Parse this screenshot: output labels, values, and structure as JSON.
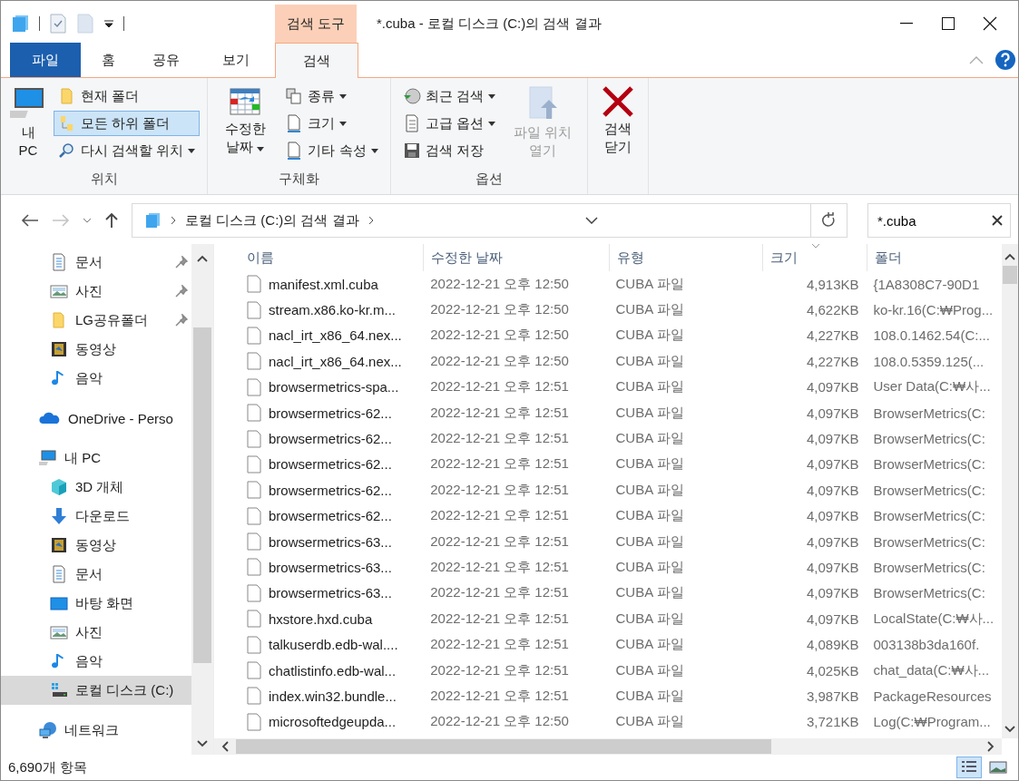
{
  "window": {
    "title": "*.cuba - 로컬 디스크 (C:)의 검색 결과",
    "context_tab": "검색 도구"
  },
  "tabs": [
    {
      "label": "파일",
      "kind": "file",
      "selected": false
    },
    {
      "label": "홈",
      "kind": "tab",
      "selected": false
    },
    {
      "label": "공유",
      "kind": "tab",
      "selected": false
    },
    {
      "label": "보기",
      "kind": "tab",
      "selected": false
    },
    {
      "label": "검색",
      "kind": "tab",
      "selected": true
    }
  ],
  "ribbon": {
    "groups": [
      {
        "label": "위치",
        "columns": [
          [
            {
              "label": "내 PC",
              "kind": "pc"
            }
          ],
          [
            {
              "label": "현재 폴더",
              "kind": "folder",
              "selected": false
            },
            {
              "label": "모든 하위 폴더",
              "kind": "subfolders",
              "selected": true
            },
            {
              "label": "다시 검색할 위치",
              "kind": "research",
              "dropdown": true,
              "selected": false
            }
          ]
        ]
      },
      {
        "label": "구체화",
        "columns": [
          [
            {
              "label": "수정한 날짜",
              "kind": "calendar",
              "dropdown": true
            }
          ],
          [
            {
              "label": "종류",
              "kind": "kind",
              "dropdown": true
            },
            {
              "label": "크기",
              "kind": "page",
              "dropdown": true
            },
            {
              "label": "기타 속성",
              "kind": "page",
              "dropdown": true
            }
          ]
        ]
      },
      {
        "label": "옵션",
        "columns": [
          [
            {
              "label": "최근 검색",
              "kind": "recent",
              "dropdown": true
            },
            {
              "label": "고급 옵션",
              "kind": "advanced",
              "dropdown": true
            },
            {
              "label": "검색 저장",
              "kind": "save"
            }
          ],
          [
            {
              "label": "파일 위치 열기",
              "kind": "openloc",
              "disabled": true
            }
          ]
        ]
      },
      {
        "columns": [
          [
            {
              "label": "검색 닫기",
              "kind": "closex"
            }
          ]
        ]
      }
    ]
  },
  "address": {
    "path": "로컬 디스크 (C:)의 검색 결과"
  },
  "search": {
    "value": "*.cuba"
  },
  "sidebar": {
    "quick_access": [
      {
        "label": "문서",
        "kind": "documents",
        "pinned": true,
        "selected": false
      },
      {
        "label": "사진",
        "kind": "pictures",
        "pinned": true,
        "selected": false
      },
      {
        "label": "LG공유폴더",
        "kind": "folder",
        "pinned": true,
        "selected": false
      },
      {
        "label": "동영상",
        "kind": "videos",
        "pinned": false,
        "selected": false
      },
      {
        "label": "음악",
        "kind": "music",
        "pinned": false,
        "selected": false
      }
    ],
    "tree": [
      {
        "label": "OneDrive - Perso",
        "kind": "cloud",
        "selected": false
      },
      {
        "label": "내 PC",
        "kind": "pc",
        "selected": false,
        "children": [
          {
            "label": "3D 개체",
            "kind": "cube",
            "selected": false
          },
          {
            "label": "다운로드",
            "kind": "downloads",
            "selected": false
          },
          {
            "label": "동영상",
            "kind": "videos",
            "selected": false
          },
          {
            "label": "문서",
            "kind": "documents",
            "selected": false
          },
          {
            "label": "바탕 화면",
            "kind": "desktop",
            "selected": false
          },
          {
            "label": "사진",
            "kind": "pictures",
            "selected": false
          },
          {
            "label": "음악",
            "kind": "music",
            "selected": false
          },
          {
            "label": "로컬 디스크 (C:)",
            "kind": "drive",
            "selected": true
          }
        ]
      },
      {
        "label": "네트워크",
        "kind": "network",
        "selected": false
      }
    ]
  },
  "table": {
    "columns": [
      "이름",
      "수정한 날짜",
      "유형",
      "크기",
      "폴더"
    ],
    "rows": [
      [
        "manifest.xml.cuba",
        "2022-12-21 오후 12:50",
        "CUBA 파일",
        "4,913KB",
        "{1A8308C7-90D1"
      ],
      [
        "stream.x86.ko-kr.m...",
        "2022-12-21 오후 12:50",
        "CUBA 파일",
        "4,622KB",
        "ko-kr.16(C:₩Prog..."
      ],
      [
        "nacl_irt_x86_64.nex...",
        "2022-12-21 오후 12:50",
        "CUBA 파일",
        "4,227KB",
        "108.0.1462.54(C:..."
      ],
      [
        "nacl_irt_x86_64.nex...",
        "2022-12-21 오후 12:50",
        "CUBA 파일",
        "4,227KB",
        "108.0.5359.125(..."
      ],
      [
        "browsermetrics-spa...",
        "2022-12-21 오후 12:51",
        "CUBA 파일",
        "4,097KB",
        "User Data(C:₩사..."
      ],
      [
        "browsermetrics-62...",
        "2022-12-21 오후 12:51",
        "CUBA 파일",
        "4,097KB",
        "BrowserMetrics(C:"
      ],
      [
        "browsermetrics-62...",
        "2022-12-21 오후 12:51",
        "CUBA 파일",
        "4,097KB",
        "BrowserMetrics(C:"
      ],
      [
        "browsermetrics-62...",
        "2022-12-21 오후 12:51",
        "CUBA 파일",
        "4,097KB",
        "BrowserMetrics(C:"
      ],
      [
        "browsermetrics-62...",
        "2022-12-21 오후 12:51",
        "CUBA 파일",
        "4,097KB",
        "BrowserMetrics(C:"
      ],
      [
        "browsermetrics-62...",
        "2022-12-21 오후 12:51",
        "CUBA 파일",
        "4,097KB",
        "BrowserMetrics(C:"
      ],
      [
        "browsermetrics-63...",
        "2022-12-21 오후 12:51",
        "CUBA 파일",
        "4,097KB",
        "BrowserMetrics(C:"
      ],
      [
        "browsermetrics-63...",
        "2022-12-21 오후 12:51",
        "CUBA 파일",
        "4,097KB",
        "BrowserMetrics(C:"
      ],
      [
        "browsermetrics-63...",
        "2022-12-21 오후 12:51",
        "CUBA 파일",
        "4,097KB",
        "BrowserMetrics(C:"
      ],
      [
        "hxstore.hxd.cuba",
        "2022-12-21 오후 12:51",
        "CUBA 파일",
        "4,097KB",
        "LocalState(C:₩사..."
      ],
      [
        "talkuserdb.edb-wal....",
        "2022-12-21 오후 12:51",
        "CUBA 파일",
        "4,089KB",
        "003138b3da160f."
      ],
      [
        "chatlistinfo.edb-wal...",
        "2022-12-21 오후 12:51",
        "CUBA 파일",
        "4,025KB",
        "chat_data(C:₩사..."
      ],
      [
        "index.win32.bundle...",
        "2022-12-21 오후 12:51",
        "CUBA 파일",
        "3,987KB",
        "PackageResources"
      ],
      [
        "microsoftedgeupda...",
        "2022-12-21 오후 12:50",
        "CUBA 파일",
        "3,721KB",
        "Log(C:₩Program..."
      ]
    ]
  },
  "status_bar": {
    "count": "6,690개 항목",
    "view_buttons": [
      {
        "kind": "details",
        "selected": true
      },
      {
        "kind": "thumbnails",
        "selected": false
      }
    ]
  }
}
